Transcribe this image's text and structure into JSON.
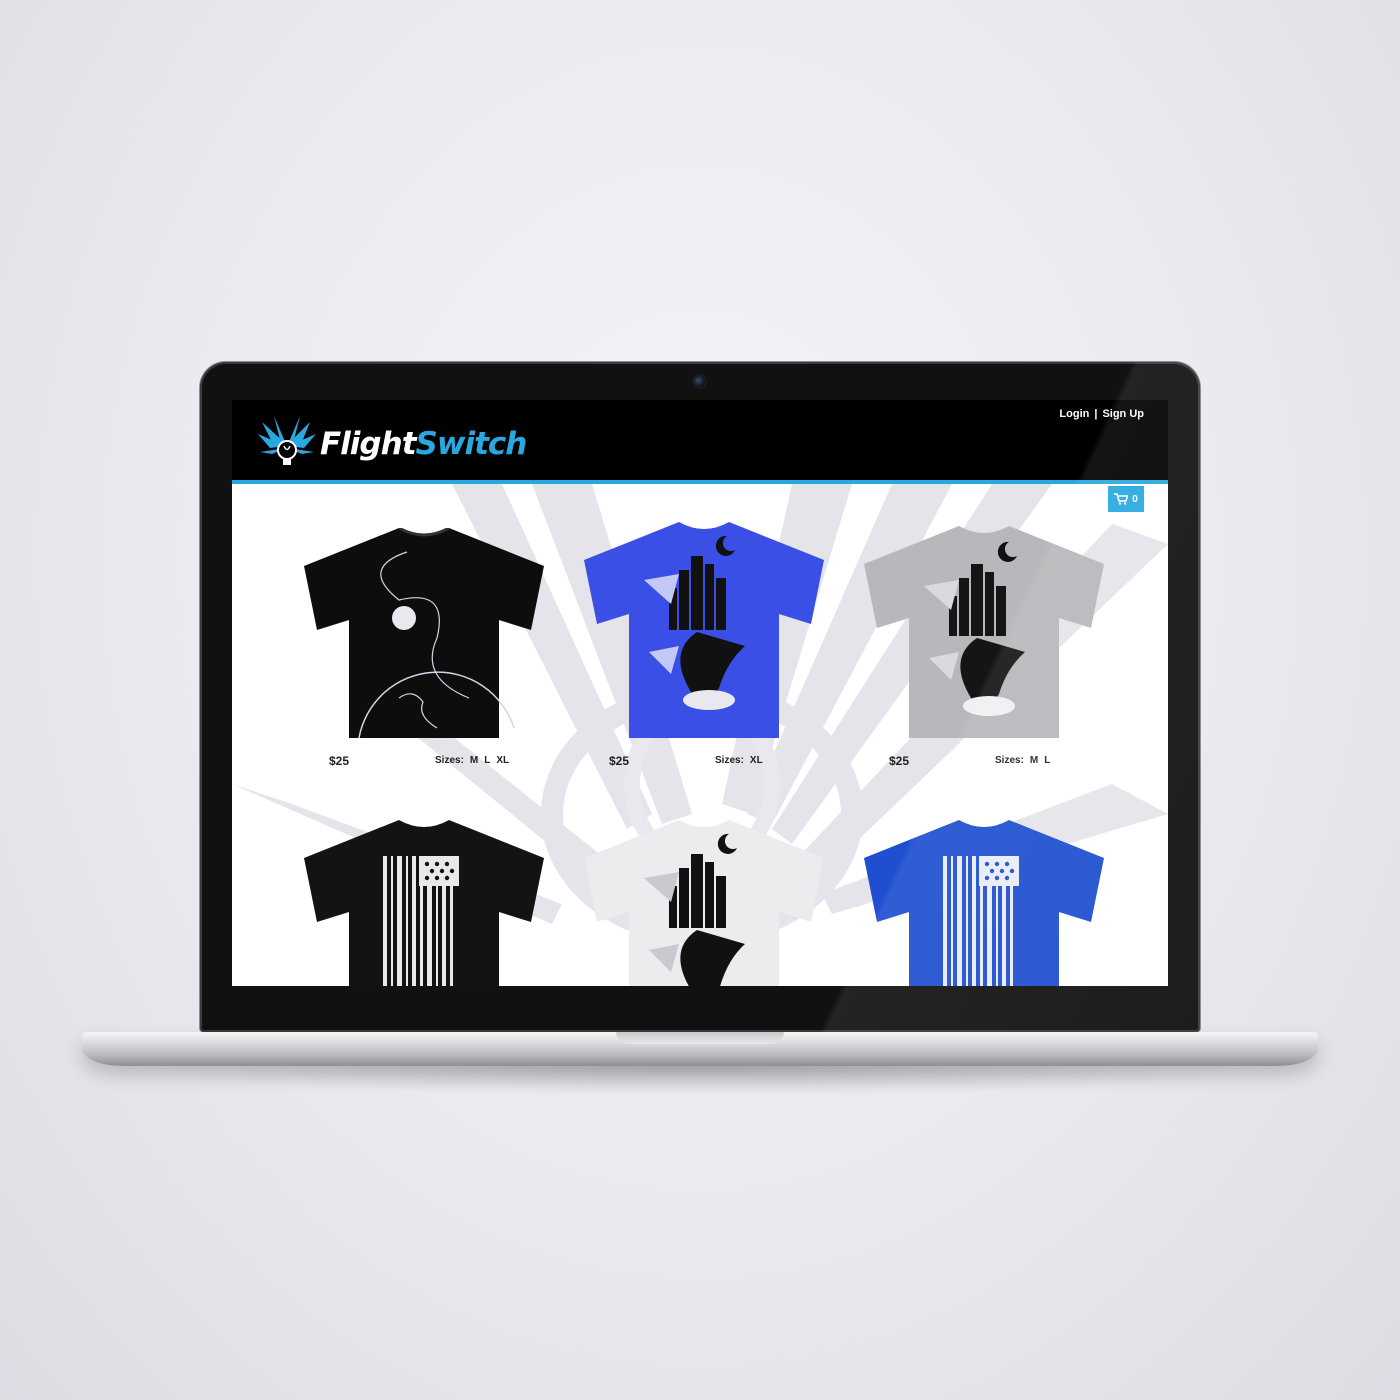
{
  "brand": {
    "word1": "Flight",
    "word2": "Switch"
  },
  "auth": {
    "login": "Login",
    "separator": "|",
    "signup": "Sign Up"
  },
  "cart": {
    "count": "0"
  },
  "products": [
    {
      "price": "$25",
      "sizes_label": "Sizes:",
      "sizes": [
        "M",
        "L",
        "XL"
      ],
      "color": "black",
      "graphic": "astronaut-earth"
    },
    {
      "price": "$25",
      "sizes_label": "Sizes:",
      "sizes": [
        "XL"
      ],
      "color": "blue",
      "graphic": "city-hand"
    },
    {
      "price": "$25",
      "sizes_label": "Sizes:",
      "sizes": [
        "M",
        "L"
      ],
      "color": "gray",
      "graphic": "city-hand"
    },
    {
      "color": "black",
      "graphic": "barcode-flag"
    },
    {
      "color": "white",
      "graphic": "city-hand"
    },
    {
      "color": "blue",
      "graphic": "barcode-flag"
    }
  ],
  "colors": {
    "accent": "#29a8e0",
    "header": "#000000",
    "shirt_blue": "#3a4fe6",
    "shirt_gray": "#b8b8bc",
    "shirt_royal": "#1f4fd0"
  }
}
